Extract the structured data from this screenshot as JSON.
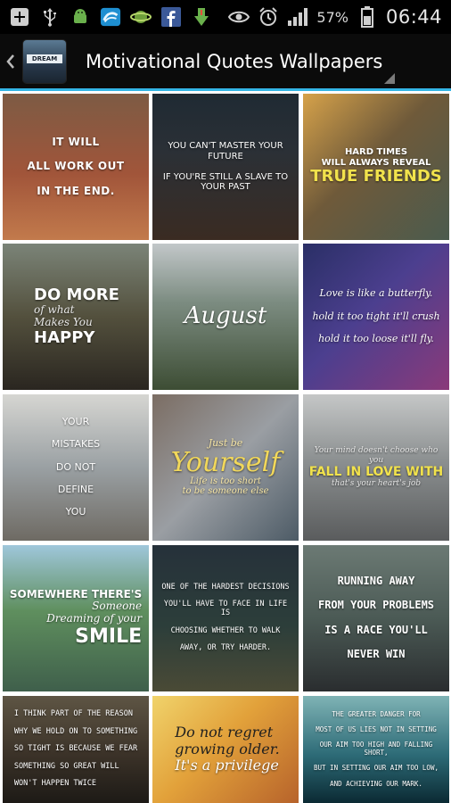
{
  "statusbar": {
    "battery_percent": "57%",
    "time": "06:44"
  },
  "actionbar": {
    "title": "Motivational Quotes Wallpapers",
    "app_icon_text": "DREAM"
  },
  "colors": {
    "accent": "#33b5e5",
    "statusbar_bg": "#000000",
    "actionbar_bg": "#0b0b0b"
  },
  "grid": {
    "tiles": [
      {
        "lines": [
          "IT WILL",
          "ALL WORK OUT",
          "IN THE END."
        ]
      },
      {
        "lines": [
          "YOU CAN'T MASTER YOUR FUTURE",
          "IF YOU'RE STILL A SLAVE TO YOUR PAST"
        ]
      },
      {
        "lines": [
          "HARD TIMES",
          "WILL ALWAYS REVEAL"
        ],
        "highlight": "TRUE FRIENDS"
      },
      {
        "lines": [
          "DO MORE",
          "of what",
          "Makes You",
          "HAPPY"
        ]
      },
      {
        "lines": [
          "August"
        ]
      },
      {
        "lines": [
          "Love is like a butterfly.",
          "hold it too tight it'll crush",
          "hold it too loose it'll fly."
        ]
      },
      {
        "lines": [
          "YOUR",
          "MISTAKES",
          "DO NOT",
          "DEFINE",
          "YOU"
        ]
      },
      {
        "lines": [
          "Just be",
          "Yourself",
          "Life is too short",
          "to be someone else"
        ]
      },
      {
        "lines": [
          "Your mind doesn't choose who you",
          "FALL IN LOVE WITH",
          "that's your heart's job"
        ]
      },
      {
        "lines": [
          "SOMEWHERE THERE'S",
          "Someone",
          "Dreaming of your",
          "SMILE"
        ]
      },
      {
        "lines": [
          "ONE OF THE HARDEST DECISIONS",
          "YOU'LL HAVE TO FACE IN LIFE IS",
          "CHOOSING WHETHER TO WALK",
          "AWAY, OR TRY HARDER."
        ]
      },
      {
        "lines": [
          "RUNNING AWAY",
          "FROM YOUR PROBLEMS",
          "IS A RACE YOU'LL",
          "NEVER WIN"
        ]
      },
      {
        "lines": [
          "I THINK PART OF THE REASON",
          "WHY WE HOLD ON TO SOMETHING",
          "SO TIGHT IS BECAUSE WE FEAR",
          "SOMETHING SO GREAT WILL",
          "WON'T HAPPEN TWICE"
        ]
      },
      {
        "lines": [
          "Do not regret",
          "growing older.",
          "It's a privilege"
        ]
      },
      {
        "lines": [
          "THE GREATER DANGER FOR",
          "MOST OF US LIES NOT IN SETTING",
          "OUR AIM TOO HIGH AND FALLING SHORT,",
          "BUT IN SETTING OUR AIM TOO LOW,",
          "AND ACHIEVING OUR MARK."
        ]
      }
    ]
  }
}
